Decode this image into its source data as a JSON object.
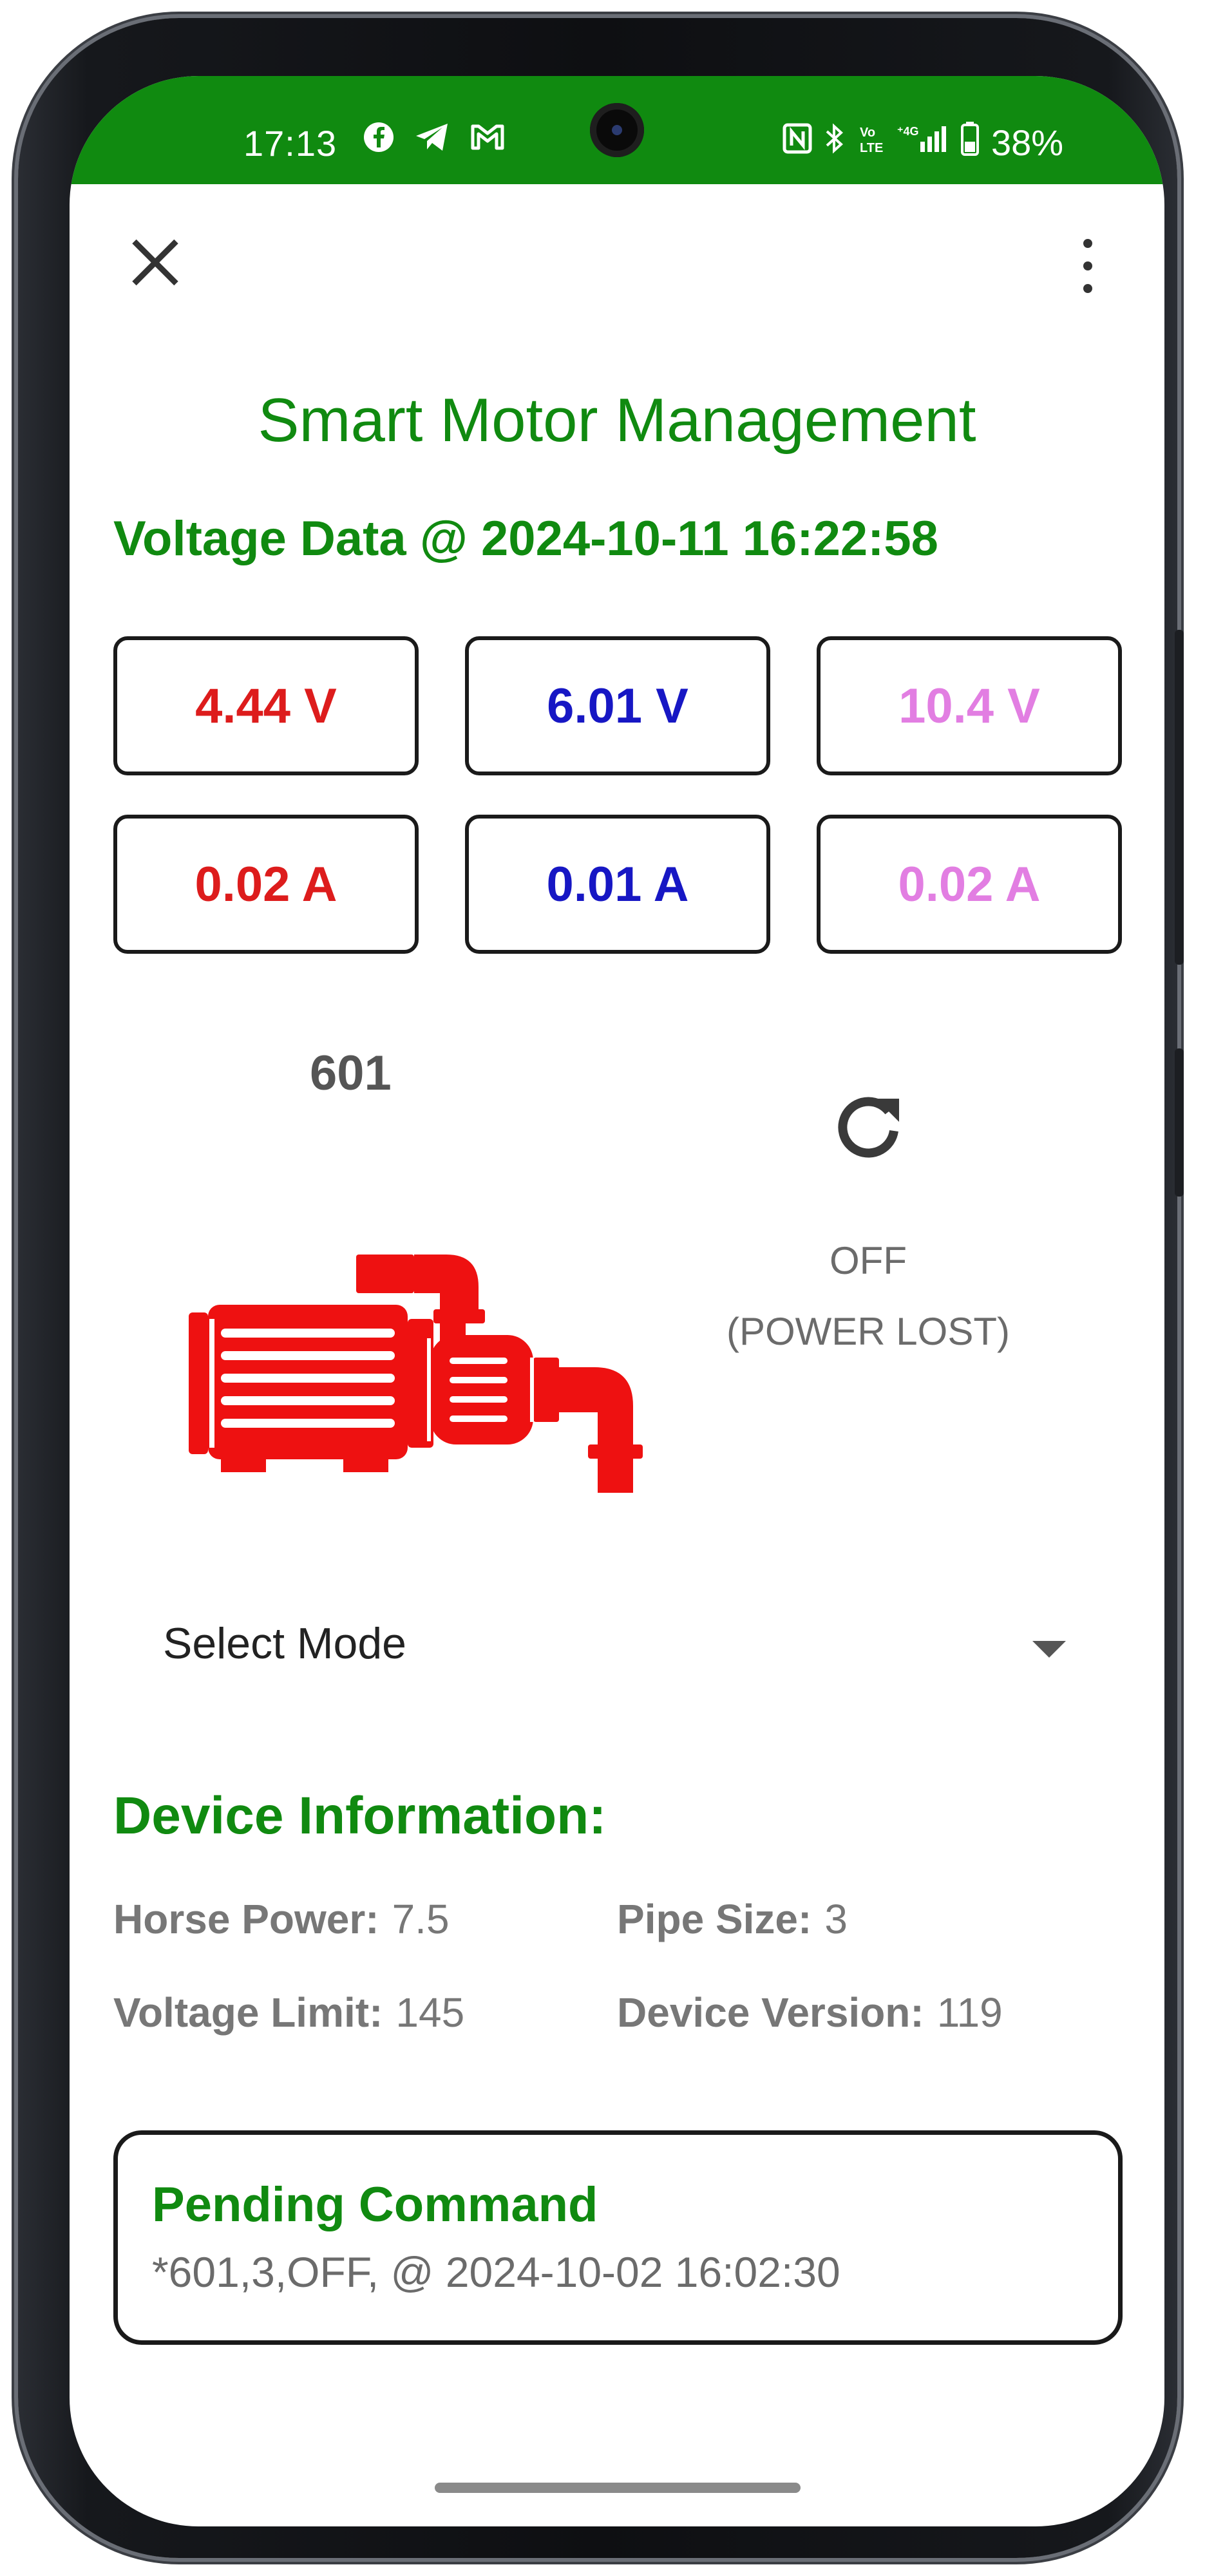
{
  "status_bar": {
    "time": "17:13",
    "left_icons": [
      "facebook-icon",
      "telegram-icon",
      "gmail-icon"
    ],
    "right_icons": [
      "nfc-icon",
      "bluetooth-icon",
      "volte-icon",
      "signal-icon",
      "battery-icon"
    ],
    "battery_percent": "38%",
    "background_color": "#108a10"
  },
  "app": {
    "title": "Smart Motor Management",
    "accent_color": "#108a10"
  },
  "voltage": {
    "header": "Voltage Data @ 2024-10-11 16:22:58",
    "readings": [
      {
        "value": "4.44 V",
        "color": "#dd1c1c"
      },
      {
        "value": "6.01 V",
        "color": "#1717c4"
      },
      {
        "value": "10.4 V",
        "color": "#e27ee2"
      },
      {
        "value": "0.02 A",
        "color": "#dd1c1c"
      },
      {
        "value": "0.01 A",
        "color": "#1717c4"
      },
      {
        "value": "0.02 A",
        "color": "#e27ee2"
      }
    ]
  },
  "device": {
    "id": "601",
    "status": "OFF",
    "status_reason": "(POWER LOST)",
    "pump_icon": "water-pump-icon",
    "pump_color": "#ee1111"
  },
  "mode": {
    "placeholder": "Select Mode"
  },
  "device_info": {
    "title": "Device Information:",
    "items": [
      {
        "label": "Horse Power:",
        "value": "7.5"
      },
      {
        "label": "Pipe Size:",
        "value": "3"
      },
      {
        "label": "Voltage Limit:",
        "value": "145"
      },
      {
        "label": "Device Version:",
        "value": "119"
      }
    ]
  },
  "pending": {
    "title": "Pending Command",
    "command": "*601,3,OFF, @ 2024-10-02 16:02:30"
  }
}
